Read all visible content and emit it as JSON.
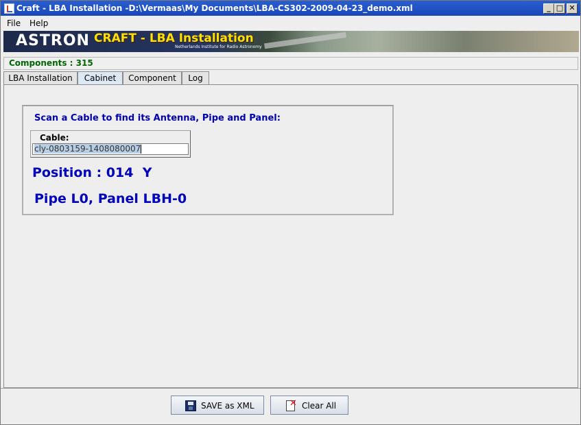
{
  "window": {
    "title": "Craft - LBA Installation -D:\\Vermaas\\My Documents\\LBA-CS302-2009-04-23_demo.xml",
    "minimize_glyph": "_",
    "maximize_glyph": "□",
    "close_glyph": "✕"
  },
  "menu": {
    "items": [
      "File",
      "Help"
    ]
  },
  "banner": {
    "logo_text": "ASTRON",
    "title": "CRAFT - LBA Installation",
    "subtitle": "Netherlands Institute for Radio Astronomy"
  },
  "status": {
    "components": "Components : 315"
  },
  "tabs": [
    {
      "label": "LBA Installation",
      "active": false
    },
    {
      "label": "Cabinet",
      "active": true
    },
    {
      "label": "Component",
      "active": false
    },
    {
      "label": "Log",
      "active": false
    }
  ],
  "cabinet": {
    "scan_title": "Scan a Cable to find its Antenna, Pipe and Panel:",
    "cable_label": "Cable:",
    "cable_value": "cly-0803159-1408080007",
    "position_text": "Position : 014  Y",
    "pipe_panel_text": "Pipe L0, Panel LBH-0"
  },
  "buttons": {
    "save_label": "SAVE as XML",
    "clear_label": "Clear All"
  },
  "colors": {
    "title_blue": "#0000aa",
    "status_green": "#006600",
    "titlebar": "#1a46b8"
  }
}
